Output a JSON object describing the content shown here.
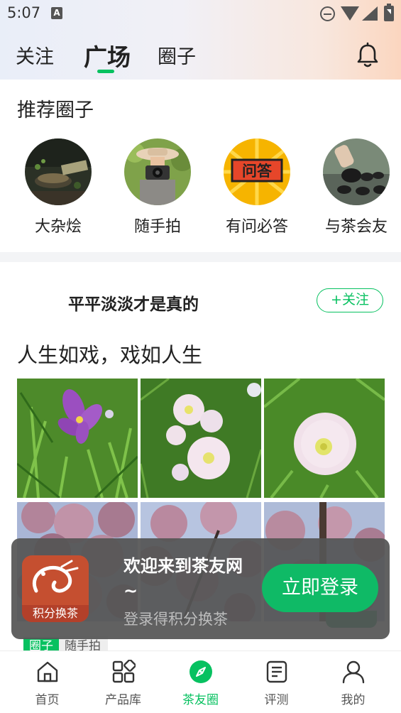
{
  "status_bar": {
    "time": "5:07",
    "notification_icon": "A"
  },
  "top_tabs": [
    {
      "label": "关注",
      "active": false
    },
    {
      "label": "广场",
      "active": true
    },
    {
      "label": "圈子",
      "active": false
    }
  ],
  "recommended": {
    "title": "推荐圈子",
    "circles": [
      {
        "name": "大杂烩"
      },
      {
        "name": "随手拍"
      },
      {
        "name": "有问必答",
        "badge_text": "问答"
      },
      {
        "name": "与茶会友"
      }
    ]
  },
  "post": {
    "author": "平平淡淡才是真的",
    "follow_label": "+关注",
    "text": "人生如戏，戏如人生",
    "tag_badge": "圈子",
    "tag_name": "随手拍"
  },
  "login_banner": {
    "title": "欢迎来到茶友网~",
    "subtitle": "登录得积分换茶",
    "logo_text": "积分换茶",
    "button_label": "立即登录"
  },
  "bottom_nav": [
    {
      "label": "首页",
      "icon": "home-icon",
      "active": false
    },
    {
      "label": "产品库",
      "icon": "grid-icon",
      "active": false
    },
    {
      "label": "茶友圈",
      "icon": "compass-icon",
      "active": true
    },
    {
      "label": "评测",
      "icon": "document-icon",
      "active": false
    },
    {
      "label": "我的",
      "icon": "person-icon",
      "active": false
    }
  ],
  "colors": {
    "accent": "#07c160",
    "banner_bg": "#555555",
    "login_button": "#0fba66"
  }
}
